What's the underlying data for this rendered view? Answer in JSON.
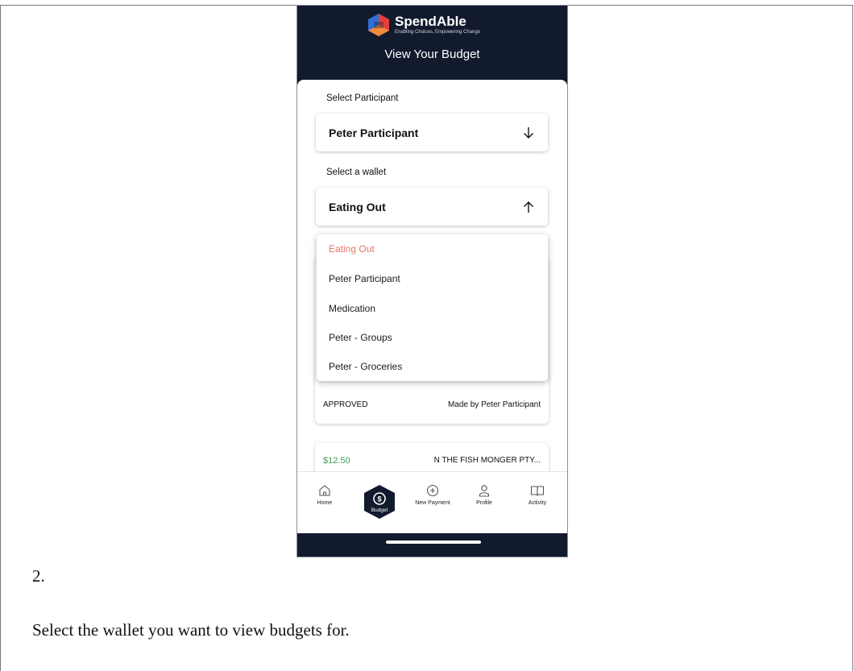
{
  "app": {
    "brand_name": "SpendAble",
    "brand_tagline": "Enabling Choices, Empowering Change",
    "screen_title": "View Your Budget"
  },
  "participant": {
    "label": "Select Participant",
    "value": "Peter Participant"
  },
  "wallet": {
    "label": "Select a wallet",
    "value": "Eating Out",
    "options": [
      "Eating Out",
      "Peter Participant",
      "Medication",
      "Peter - Groups",
      "Peter - Groceries"
    ],
    "selected_color": "#e8746a"
  },
  "transactions": [
    {
      "status": "APPROVED",
      "made_by": "Made by Peter Participant"
    },
    {
      "amount": "$12.50",
      "merchant": "N THE FISH MONGER PTY..."
    }
  ],
  "tabs": [
    {
      "label": "Home",
      "icon": "home-icon"
    },
    {
      "label": "Budget",
      "icon": "dollar-icon",
      "active": true
    },
    {
      "label": "New Payment",
      "icon": "plus-circle-icon"
    },
    {
      "label": "Profile",
      "icon": "person-icon"
    },
    {
      "label": "Activity",
      "icon": "book-icon"
    }
  ],
  "instruction": {
    "step": "2.",
    "text": "Select the wallet you want to view budgets for."
  },
  "colors": {
    "header_bg": "#121a2d",
    "amount_green": "#3aa055",
    "logo_blue": "#2d6fd8",
    "logo_red": "#e2403a"
  }
}
